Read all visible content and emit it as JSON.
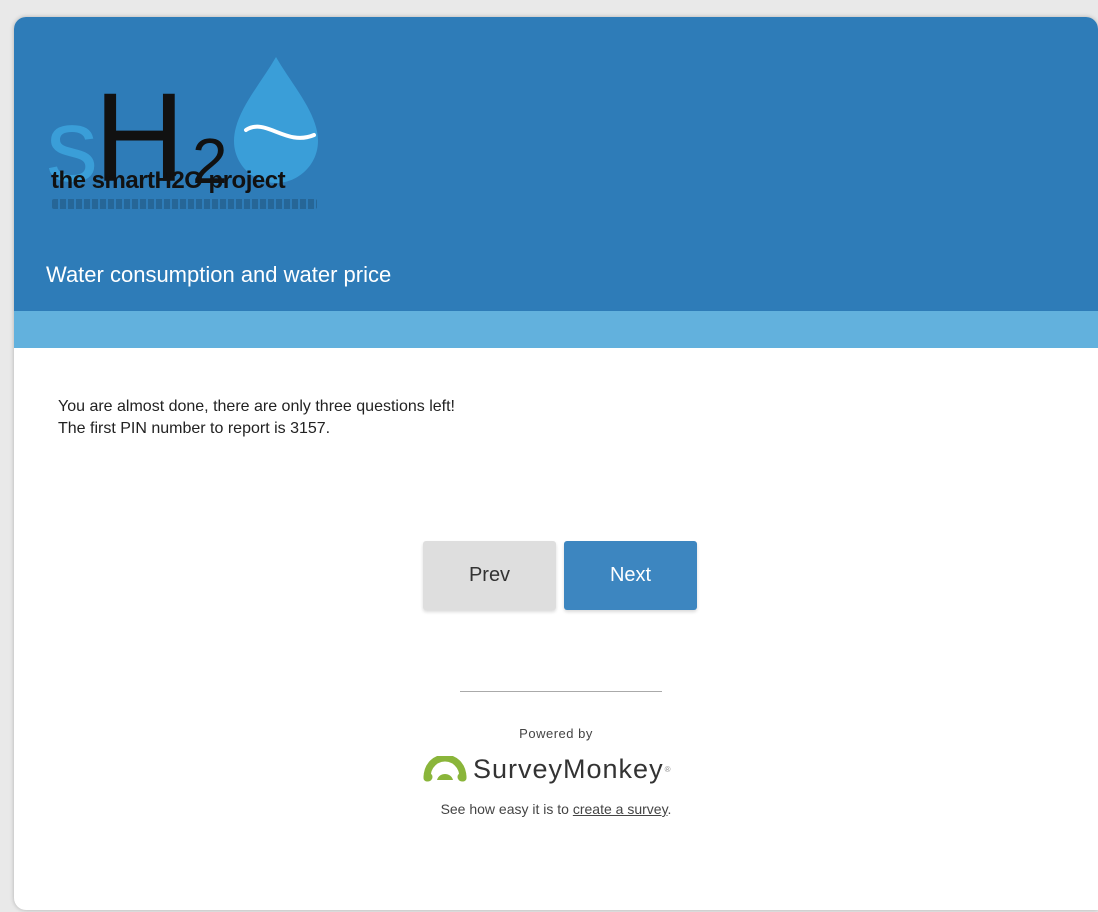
{
  "header": {
    "logo_text": "sH2",
    "logo_caption": "the smartH2O project",
    "survey_title": "Water consumption and water price",
    "colors": {
      "header": "#2e7cb8",
      "stripe": "#62b1dd"
    }
  },
  "content": {
    "line1": "You are almost done, there are only three questions left!",
    "line2": "The first PIN number to report is 3157."
  },
  "nav": {
    "prev_label": "Prev",
    "next_label": "Next"
  },
  "footer": {
    "powered_by": "Powered by",
    "brand_name": "SurveyMonkey",
    "brand_mark": "®",
    "tagline_prefix": "See how easy it is to ",
    "tagline_link": "create a survey",
    "tagline_suffix": "."
  }
}
